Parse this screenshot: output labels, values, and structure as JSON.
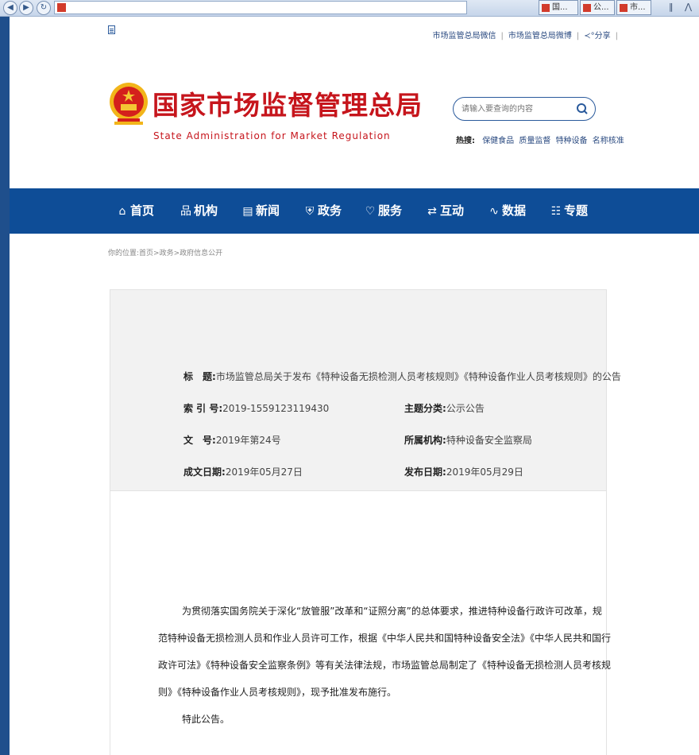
{
  "browser": {
    "tabs": [
      "国...",
      "公...",
      "市..."
    ]
  },
  "site": {
    "toplinks": [
      "市场监管总局微信",
      "市场监管总局微博",
      "分享"
    ],
    "logo_cn": "国家市场监督管理总局",
    "logo_en": "State Administration for Market Regulation",
    "search_placeholder": "请输入要查询的内容",
    "hot_label": "热搜:",
    "hot_links": [
      "保健食品",
      "质量监督",
      "特种设备",
      "名称核准"
    ]
  },
  "nav": [
    {
      "icon": "home-icon",
      "glyph": "⌂",
      "label": "首页"
    },
    {
      "icon": "org-icon",
      "glyph": "品",
      "label": "机构"
    },
    {
      "icon": "news-icon",
      "glyph": "▤",
      "label": "新闻"
    },
    {
      "icon": "shield-icon",
      "glyph": "⛨",
      "label": "政务"
    },
    {
      "icon": "heart-icon",
      "glyph": "♡",
      "label": "服务"
    },
    {
      "icon": "exchange-icon",
      "glyph": "⇄",
      "label": "互动"
    },
    {
      "icon": "chart-icon",
      "glyph": "∿",
      "label": "数据"
    },
    {
      "icon": "list-icon",
      "glyph": "☷",
      "label": "专题"
    }
  ],
  "breadcrumb": "你的位置:首页>政务>政府信息公开",
  "meta": {
    "title_label": "标　题:",
    "title_value": "市场监管总局关于发布《特种设备无损检测人员考核规则》《特种设备作业人员考核规则》的公告",
    "index_label": "索 引 号:",
    "index_value": "2019-1559123119430",
    "category_label": "主题分类:",
    "category_value": "公示公告",
    "docno_label": "文　号:",
    "docno_value": "2019年第24号",
    "org_label": "所属机构:",
    "org_value": "特种设备安全监察局",
    "created_label": "成文日期:",
    "created_value": "2019年05月27日",
    "published_label": "发布日期:",
    "published_value": "2019年05月29日"
  },
  "content": {
    "lines": [
      "为贯彻落实国务院关于深化“放管服”改革和“证照分离”的总体要求，推进特种设备行政许可改革，规",
      "范特种设备无损检测人员和作业人员许可工作，根据《中华人民共和国特种设备安全法》《中华人民共和国行",
      "政许可法》《特种设备安全监察条例》等有关法律法规，市场监管总局制定了《特种设备无损检测人员考核规",
      "则》《特种设备作业人员考核规则》，现予批准发布施行。"
    ],
    "closing": "特此公告。"
  }
}
